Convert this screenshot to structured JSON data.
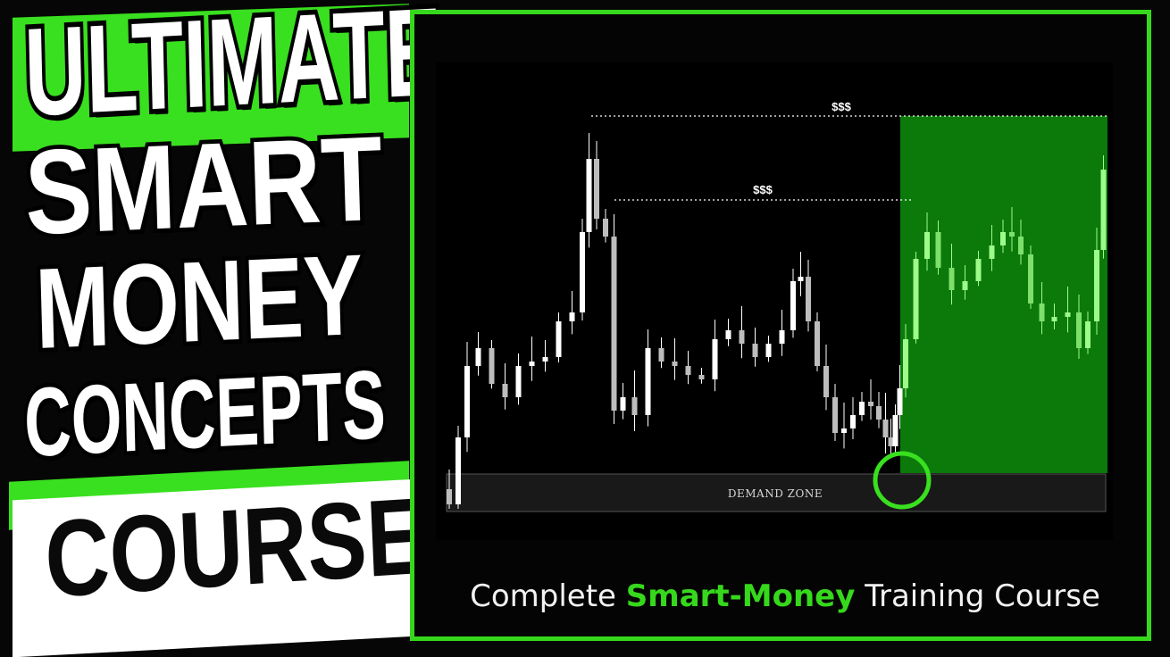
{
  "title": {
    "line1": "ULTIMATE",
    "line2": "SMART",
    "line3": "MONEY",
    "line4": "CONCEPTS",
    "line5": "COURSE"
  },
  "chart": {
    "liquidity_label_high": "$$$",
    "liquidity_label_low": "$$$",
    "zone_label": "DEMAND ZONE"
  },
  "caption": {
    "prefix": "Complete",
    "highlight": "Smart-Money",
    "suffix": "Training Course"
  },
  "colors": {
    "accent_green": "#39e01f",
    "highlight_fill": "#0b7a0b",
    "candle_white": "#ffffff",
    "candle_green": "#9dfb8a",
    "background": "#000000"
  }
}
